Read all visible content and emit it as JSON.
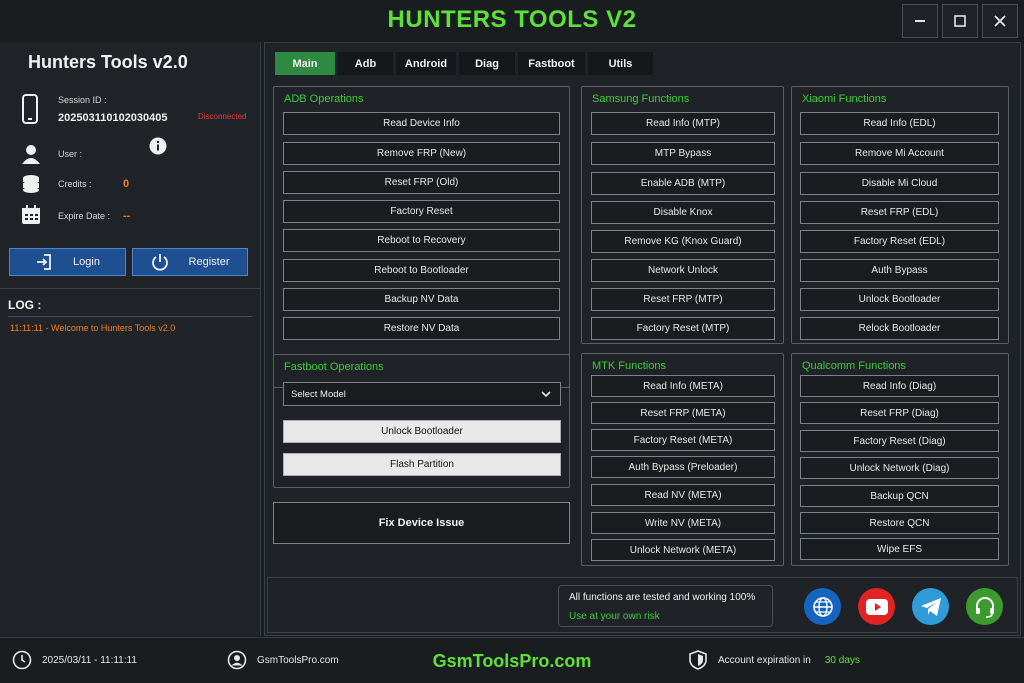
{
  "window": {
    "title": "HUNTERS TOOLS V2",
    "controls": [
      "minimize",
      "maximize",
      "close"
    ]
  },
  "sidebar": {
    "title": "Hunters Tools v2.0",
    "session_label": "Session ID :",
    "session_id": "20250311010203040 5",
    "session_id_display": "202503110102030405",
    "status": "Disconnected",
    "user_label": "User :",
    "credits_label": "Credits :",
    "credits_value": "0",
    "expire_label": "Expire Date :",
    "expire_value": "--",
    "login_label": "Login",
    "register_label": "Register",
    "log_title": "LOG :",
    "log_entries": [
      "11:11:11 - Welcome to Hunters Tools v2.0"
    ]
  },
  "tabs": [
    "Main",
    "Adb",
    "Android",
    "Diag",
    "Fastboot",
    "Utils"
  ],
  "active_tab": "Main",
  "groups": {
    "adb": {
      "title": "ADB Operations",
      "buttons": [
        "Read Device Info",
        "Remove FRP (New)",
        "Reset FRP (Old)",
        "Factory Reset",
        "Reboot to Recovery",
        "Reboot to Bootloader",
        "Backup NV Data",
        "Restore NV Data"
      ]
    },
    "samsung": {
      "title": "Samsung Functions",
      "buttons": [
        "Read Info (MTP)",
        "MTP Bypass",
        "Enable ADB (MTP)",
        "Disable Knox",
        "Remove KG (Knox Guard)",
        "Network Unlock",
        "Reset FRP (MTP)",
        "Factory Reset (MTP)"
      ]
    },
    "xiaomi": {
      "title": "Xiaomi Functions",
      "buttons": [
        "Read Info (EDL)",
        "Remove Mi Account",
        "Disable Mi Cloud",
        "Reset FRP (EDL)",
        "Factory Reset (EDL)",
        "Auth Bypass",
        "Unlock Bootloader",
        "Relock Bootloader"
      ]
    },
    "fastboot": {
      "title": "Fastboot Operations",
      "select_value": "Select Model",
      "buttons": [
        "Unlock Bootloader",
        "Flash Partition"
      ]
    },
    "mtk": {
      "title": "MTK Functions",
      "buttons": [
        "Read Info (META)",
        "Reset FRP (META)",
        "Factory Reset (META)",
        "Auth Bypass (Preloader)",
        "Read NV (META)",
        "Write NV (META)",
        "Unlock Network (META)"
      ]
    },
    "qualcomm": {
      "title": "Qualcomm Functions",
      "buttons": [
        "Read Info (Diag)",
        "Reset FRP (Diag)",
        "Factory Reset (Diag)",
        "Unlock Network (Diag)",
        "Backup QCN",
        "Restore QCN",
        "Wipe EFS"
      ]
    }
  },
  "fix_button": "Fix Device Issue",
  "notice": {
    "line1": "All functions are tested and working 100%",
    "line2": "Use at your own risk"
  },
  "social": [
    {
      "icon": "globe-icon",
      "color": "#1565c0"
    },
    {
      "icon": "youtube-icon",
      "color": "#e02424"
    },
    {
      "icon": "telegram-icon",
      "color": "#2f9bd8"
    },
    {
      "icon": "support-headset-icon",
      "color": "#3d9a2e"
    }
  ],
  "footer": {
    "datetime": "2025/03/11 - 11:11:11",
    "site": "GsmToolsPro.com",
    "brand": "GsmToolsPro.com",
    "expiry_label": "Account expiration in",
    "expiry_value": "30 days"
  },
  "colors": {
    "accent_green": "#5ee03b",
    "group_title_green": "#3fcc3a",
    "active_tab": "#2e8a43",
    "button_blue": "#1d4f91",
    "warning_orange": "#f07f1e",
    "error_red": "#e23a3a"
  }
}
